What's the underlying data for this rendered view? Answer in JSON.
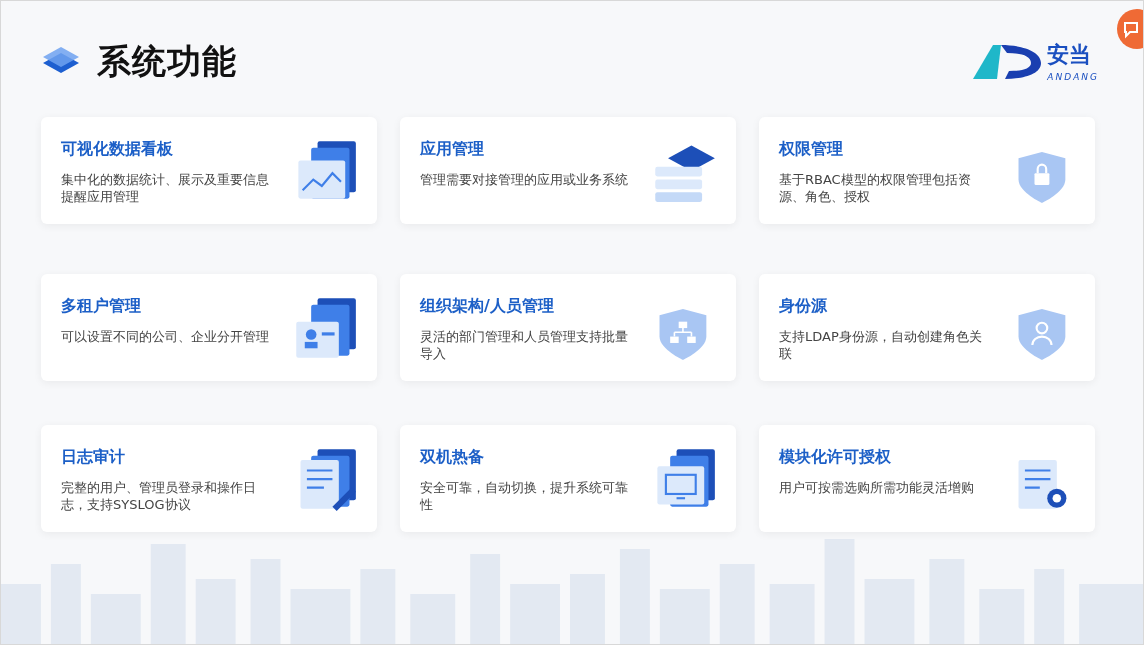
{
  "title": "系统功能",
  "logo": {
    "name": "安当",
    "subtitle": "ANDANG"
  },
  "features": [
    {
      "title": "可视化数据看板",
      "description": "集中化的数据统计、展示及重要信息提醒应用管理"
    },
    {
      "title": "应用管理",
      "description": "管理需要对接管理的应用或业务系统"
    },
    {
      "title": "权限管理",
      "description": "基于RBAC模型的权限管理包括资源、角色、授权"
    },
    {
      "title": "多租户管理",
      "description": "可以设置不同的公司、企业分开管理"
    },
    {
      "title": "组织架构/人员管理",
      "description": "灵活的部门管理和人员管理支持批量导入"
    },
    {
      "title": "身份源",
      "description": "支持LDAP身份源，自动创建角色关联"
    },
    {
      "title": "日志审计",
      "description": "完整的用户、管理员登录和操作日志，支持SYSLOG协议"
    },
    {
      "title": "双机热备",
      "description": "安全可靠，自动切换，提升系统可靠性"
    },
    {
      "title": "模块化许可授权",
      "description": "用户可按需选购所需功能灵活增购"
    }
  ]
}
